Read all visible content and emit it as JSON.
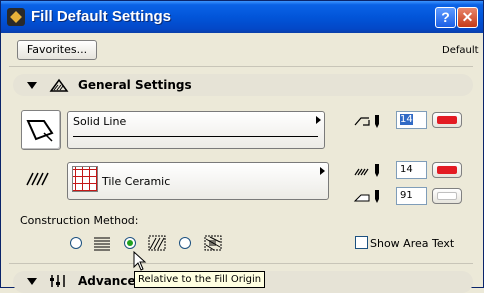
{
  "window": {
    "title": "Fill Default Settings",
    "help_label": "?",
    "close_label": "✕"
  },
  "toolbar": {
    "favorites_label": "Favorites...",
    "default_label": "Default"
  },
  "general": {
    "title": "General Settings",
    "line_type": {
      "label": "Solid Line"
    },
    "line_pen": {
      "value": "14",
      "selected": true,
      "color": "#e31b23"
    },
    "fill_type": {
      "label": "Tile Ceramic",
      "swatch_color": "#c41717"
    },
    "fill_pen": {
      "value": "14",
      "color": "#e31b23"
    },
    "bg_pen": {
      "value": "91",
      "color": "#ffffff"
    },
    "construction_label": "Construction Method:",
    "construction_options": [
      {
        "icon": "distorted-fill-icon",
        "selected": false
      },
      {
        "icon": "relative-to-origin-fill-icon",
        "selected": true
      },
      {
        "icon": "custom-origin-fill-icon",
        "selected": false
      }
    ],
    "show_area_text_label": "Show Area Text",
    "show_area_text_checked": false
  },
  "advanced": {
    "title": "Advanced"
  },
  "tooltip": {
    "text": "Relative to the Fill Origin"
  },
  "colors": {
    "titlebar": "#0255d9",
    "accent_radio": "#21a121",
    "pen_red": "#e31b23"
  }
}
